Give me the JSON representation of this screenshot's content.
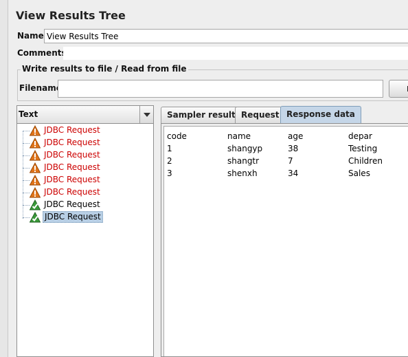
{
  "window": {
    "title": "View Results Tree"
  },
  "form": {
    "name_label": "Name:",
    "name_value": "View Results Tree",
    "comments_label": "Comments:",
    "comments_value": ""
  },
  "file_group": {
    "legend": "Write results to file / Read from file",
    "filename_label": "Filename",
    "filename_value": "",
    "browse_label": "Bro"
  },
  "tree": {
    "renderer_label": "Text",
    "items": [
      {
        "label": "JDBC Request",
        "status": "fail",
        "selected": false
      },
      {
        "label": "JDBC Request",
        "status": "fail",
        "selected": false
      },
      {
        "label": "JDBC Request",
        "status": "fail",
        "selected": false
      },
      {
        "label": "JDBC Request",
        "status": "fail",
        "selected": false
      },
      {
        "label": "JDBC Request",
        "status": "fail",
        "selected": false
      },
      {
        "label": "JDBC Request",
        "status": "fail",
        "selected": false
      },
      {
        "label": "JDBC Request",
        "status": "ok",
        "selected": false
      },
      {
        "label": "JDBC Request",
        "status": "ok",
        "selected": true
      }
    ]
  },
  "tabs": [
    {
      "label": "Sampler result",
      "active": false
    },
    {
      "label": "Request",
      "active": false
    },
    {
      "label": "Response data",
      "active": true
    }
  ],
  "response": {
    "columns": [
      "code",
      "name",
      "age",
      "depar"
    ],
    "rows": [
      [
        "1",
        "shangyp",
        "38",
        "Testing"
      ],
      [
        "2",
        "shangtr",
        "7",
        "Children"
      ],
      [
        "3",
        "shenxh",
        "34",
        "Sales"
      ]
    ]
  },
  "colors": {
    "fail_text": "#cc0000",
    "selected_bg": "#b8cfe5",
    "active_tab_bg": "#c5d6e8",
    "warning_icon": "#e0741a",
    "success_icon": "#3a9a3a"
  }
}
